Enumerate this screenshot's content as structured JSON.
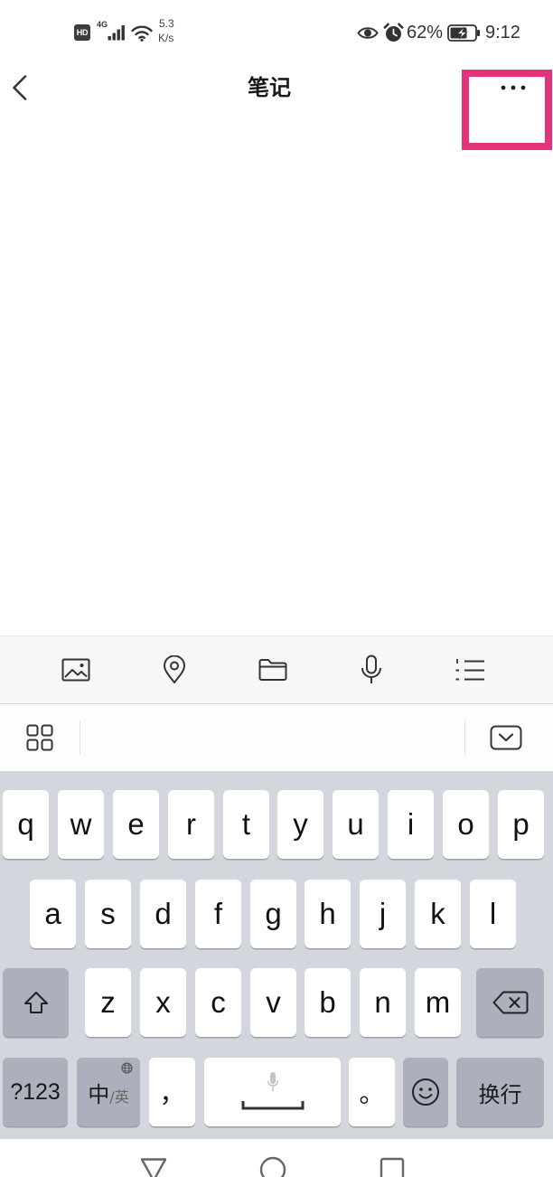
{
  "status_bar": {
    "hd_label": "HD",
    "network_type": "4G",
    "speed_value": "5.3",
    "speed_unit": "K/s",
    "battery_percent": "62%",
    "time": "9:12",
    "icons": [
      "signal-icon",
      "wifi-icon",
      "eye-icon",
      "alarm-icon",
      "battery-charging-icon"
    ]
  },
  "header": {
    "title": "笔记",
    "back_icon": "chevron-left-icon",
    "more_icon": "more-horizontal-icon"
  },
  "note_toolbar": {
    "icons": [
      "image-icon",
      "location-icon",
      "folder-icon",
      "microphone-icon",
      "numbered-list-icon"
    ]
  },
  "keyboard_bar": {
    "left_icon": "grid-icon",
    "right_icon": "keyboard-hide-icon"
  },
  "keyboard": {
    "rows": [
      [
        "q",
        "w",
        "e",
        "r",
        "t",
        "y",
        "u",
        "i",
        "o",
        "p"
      ],
      [
        "a",
        "s",
        "d",
        "f",
        "g",
        "h",
        "j",
        "k",
        "l"
      ],
      [
        "z",
        "x",
        "c",
        "v",
        "b",
        "n",
        "m"
      ]
    ],
    "shift_icon": "shift-icon",
    "backspace_icon": "backspace-icon",
    "symbols_key": "?123",
    "language_key_main": "中",
    "language_key_alt": "/英",
    "language_icon": "globe-icon",
    "comma_key": "，",
    "space_icons": [
      "microphone-icon",
      "space-icon"
    ],
    "period_key": "。",
    "emoji_icon": "emoji-icon",
    "enter_key": "换行"
  },
  "nav_bar": {
    "icons": [
      "back-triangle-icon",
      "home-circle-icon",
      "recents-square-icon"
    ]
  },
  "colors": {
    "highlight": "#e2347a",
    "toolbar_background": "#f7f7f7",
    "keyboard_background": "#d4d6dd",
    "key_background": "#ffffff",
    "function_key_background": "#abb0bc"
  }
}
